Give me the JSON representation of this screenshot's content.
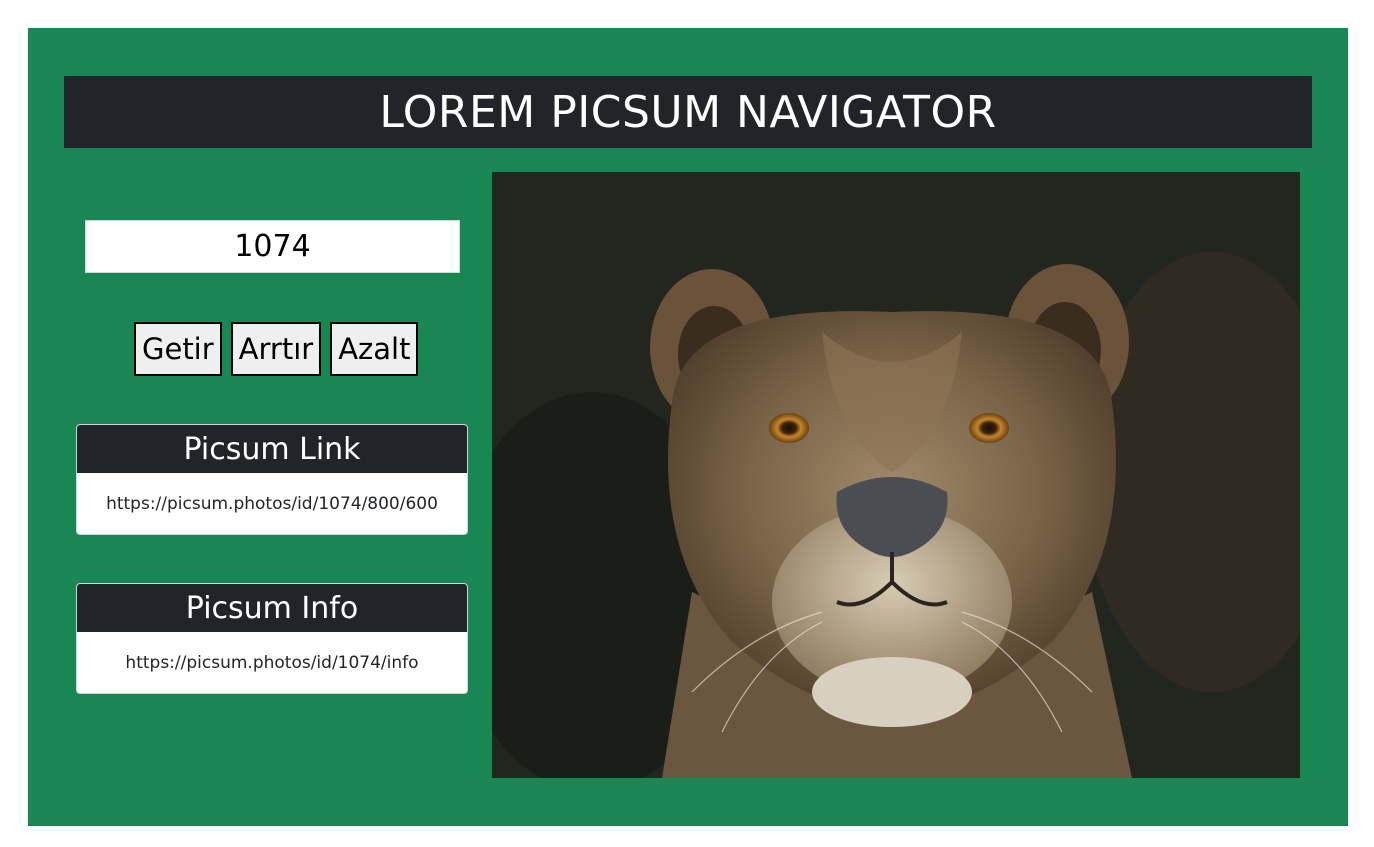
{
  "header": {
    "title": "LOREM PICSUM NAVIGATOR"
  },
  "id_input": {
    "value": "1074"
  },
  "buttons": {
    "fetch": "Getir",
    "increase": "Arrtır",
    "decrease": "Azalt"
  },
  "cards": {
    "link": {
      "title": "Picsum Link",
      "url": "https://picsum.photos/id/1074/800/600"
    },
    "info": {
      "title": "Picsum Info",
      "url": "https://picsum.photos/id/1074/info"
    }
  },
  "image": {
    "subject": "lioness"
  },
  "colors": {
    "background": "#198754",
    "header": "#212529",
    "card_body": "#ffffff"
  }
}
